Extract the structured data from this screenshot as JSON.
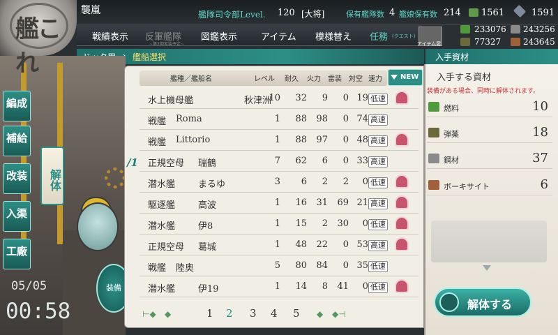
{
  "logo": {
    "kanji": "艦これ"
  },
  "header": {
    "player_name": "襲嵐",
    "hq_level_label": "艦隊司令部Level.",
    "hq_level": "120",
    "rank": "[大将]",
    "fleet_count_label": "保有艦隊数",
    "fleet_count": "4",
    "equip_count_label": "艦娘保有数",
    "equip_count": "214",
    "bucket": "1561",
    "devmat": "1591"
  },
  "menu": {
    "items": [
      "戦績表示",
      "反軍艦隊",
      "図鑑表示",
      "アイテム",
      "模様替え",
      "任務"
    ],
    "rival_sub": "~第2期実装予定~",
    "quest_sub": "(クエスト)",
    "item_shop_label": "アイテム屋"
  },
  "resources": {
    "fuel": "233076",
    "steel": "243256",
    "ammo": "77327",
    "bauxite": "243645"
  },
  "breadcrumb": {
    "dock": "ドック用",
    "select": "艦船選択"
  },
  "obtain_header": "入手資材",
  "sidebar": {
    "buttons": [
      "編成",
      "補給",
      "改装",
      "入渠",
      "工廠"
    ],
    "dismantle_tab": "解体"
  },
  "clock": {
    "date": "05/05",
    "time": "00:58"
  },
  "equip_button_label": "装備",
  "ship_table": {
    "headers": {
      "type_name": "艦種／艦船名",
      "level": "レベル",
      "hp": "耐久",
      "firepower": "火力",
      "torpedo": "雷装",
      "aa": "対空",
      "speed": "速力"
    },
    "sort_label": "NEW",
    "fleet_marker": "/1",
    "rows": [
      {
        "type": "水上機母艦",
        "name": "秋津洲",
        "level": "10",
        "hp": "32",
        "fp": "9",
        "tp": "0",
        "aa": "19",
        "speed": "低速",
        "locked": true
      },
      {
        "type": "戦艦",
        "name": "Roma",
        "level": "1",
        "hp": "88",
        "fp": "98",
        "tp": "0",
        "aa": "74",
        "speed": "高速",
        "locked": false
      },
      {
        "type": "戦艦",
        "name": "Littorio",
        "level": "1",
        "hp": "88",
        "fp": "97",
        "tp": "0",
        "aa": "48",
        "speed": "高速",
        "locked": true
      },
      {
        "type": "正規空母",
        "name": "瑞鶴",
        "level": "7",
        "hp": "62",
        "fp": "6",
        "tp": "0",
        "aa": "33",
        "speed": "高速",
        "locked": false
      },
      {
        "type": "潜水艦",
        "name": "まるゆ",
        "level": "3",
        "hp": "6",
        "fp": "2",
        "tp": "2",
        "aa": "0",
        "speed": "低速",
        "locked": true
      },
      {
        "type": "駆逐艦",
        "name": "高波",
        "level": "1",
        "hp": "16",
        "fp": "31",
        "tp": "69",
        "aa": "21",
        "speed": "高速",
        "locked": true
      },
      {
        "type": "潜水艦",
        "name": "伊8",
        "level": "1",
        "hp": "15",
        "fp": "2",
        "tp": "30",
        "aa": "0",
        "speed": "低速",
        "locked": true
      },
      {
        "type": "正規空母",
        "name": "葛城",
        "level": "1",
        "hp": "48",
        "fp": "22",
        "tp": "0",
        "aa": "53",
        "speed": "高速",
        "locked": true
      },
      {
        "type": "戦艦",
        "name": "陸奥",
        "level": "5",
        "hp": "80",
        "fp": "84",
        "tp": "0",
        "aa": "35",
        "speed": "低速",
        "locked": false
      },
      {
        "type": "潜水艦",
        "name": "伊19",
        "level": "1",
        "hp": "14",
        "fp": "8",
        "tp": "41",
        "aa": "0",
        "speed": "低速",
        "locked": true
      }
    ]
  },
  "pager": {
    "pages": [
      "1",
      "2",
      "3",
      "4",
      "5"
    ],
    "current": "2"
  },
  "gain_panel": {
    "title": "入手する資材",
    "note": "装備がある場合、同時に解体されます。",
    "items": [
      {
        "label": "燃料",
        "value": "10",
        "color": "#4f9a3a"
      },
      {
        "label": "弾薬",
        "value": "18",
        "color": "#6b6a3a"
      },
      {
        "label": "鋼材",
        "value": "37",
        "color": "#8a8a8a"
      },
      {
        "label": "ボーキサイト",
        "value": "6",
        "color": "#a0603a"
      }
    ],
    "dismantle_label": "解体する"
  }
}
